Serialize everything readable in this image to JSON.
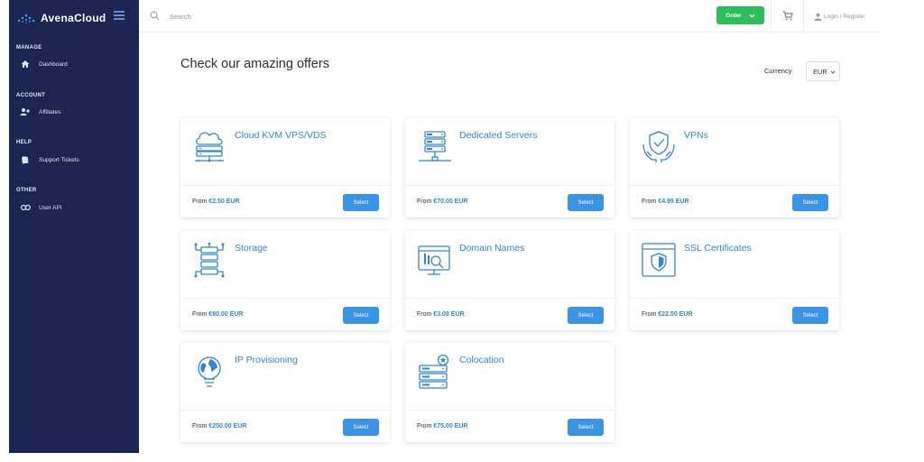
{
  "brand": {
    "name": "AvenaCloud"
  },
  "sidebar": {
    "sections": [
      {
        "title": "MANAGE",
        "item": "Dashboard",
        "icon": "home-icon"
      },
      {
        "title": "ACCOUNT",
        "item": "Affiliates",
        "icon": "users-icon"
      },
      {
        "title": "HELP",
        "item": "Support Tickets",
        "icon": "ticket-icon"
      },
      {
        "title": "OTHER",
        "item": "User API",
        "icon": "link-icon"
      }
    ]
  },
  "topbar": {
    "search_placeholder": "Search",
    "order_label": "Order",
    "login_label": "Login / Register"
  },
  "main": {
    "title": "Check our amazing offers",
    "currency_label": "Currency",
    "currency_value": "EUR"
  },
  "offers": [
    {
      "title": "Cloud KVM VPS/VDS",
      "price_prefix": "From",
      "price": "€2.50 EUR",
      "button": "Select",
      "icon": "cloud-server-icon"
    },
    {
      "title": "Dedicated Servers",
      "price_prefix": "From",
      "price": "€70.00 EUR",
      "button": "Select",
      "icon": "server-rack-icon"
    },
    {
      "title": "VPNs",
      "price_prefix": "From",
      "price": "€4.99 EUR",
      "button": "Select",
      "icon": "shield-hands-icon"
    },
    {
      "title": "Storage",
      "price_prefix": "From",
      "price": "€80.00 EUR",
      "button": "Select",
      "icon": "storage-icon"
    },
    {
      "title": "Domain Names",
      "price_prefix": "From",
      "price": "€3.08 EUR",
      "button": "Select",
      "icon": "domain-search-icon"
    },
    {
      "title": "SSL Certificates",
      "price_prefix": "From",
      "price": "€22.50 EUR",
      "button": "Select",
      "icon": "ssl-shield-icon"
    },
    {
      "title": "IP Provisioning",
      "price_prefix": "From",
      "price": "€250.00 EUR",
      "button": "Select",
      "icon": "globe-bulb-icon"
    },
    {
      "title": "Colocation",
      "price_prefix": "From",
      "price": "€75.00 EUR",
      "button": "Select",
      "icon": "colocation-icon"
    }
  ],
  "colors": {
    "sidebar_bg": "#1b2550",
    "accent_blue": "#2f86d8",
    "button_blue": "#3b93e6",
    "order_green": "#2dbd5a"
  }
}
